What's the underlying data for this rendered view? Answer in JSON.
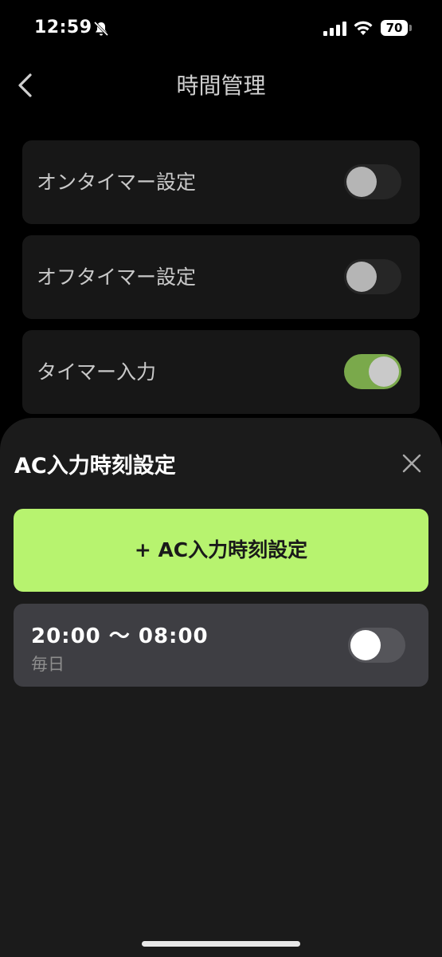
{
  "status_bar": {
    "time": "12:59",
    "battery": "70",
    "icons": [
      "bell-slash-icon",
      "signal-icon",
      "wifi-icon",
      "battery-icon"
    ]
  },
  "header": {
    "title": "時間管理",
    "back_icon": "chevron-left-icon"
  },
  "settings": [
    {
      "label": "オンタイマー設定",
      "enabled": false
    },
    {
      "label": "オフタイマー設定",
      "enabled": false
    },
    {
      "label": "タイマー入力",
      "enabled": true
    }
  ],
  "sheet": {
    "title": "AC入力時刻設定",
    "close_icon": "close-icon",
    "add_button_label": "+ AC入力時刻設定",
    "schedules": [
      {
        "time_range": "20:00 〜 08:00",
        "repeat": "毎日",
        "enabled": true
      }
    ]
  },
  "colors": {
    "accent": "#b7f36f",
    "toggle_on": "#7aa94b",
    "background": "#000000",
    "sheet": "#1b1b1b"
  }
}
